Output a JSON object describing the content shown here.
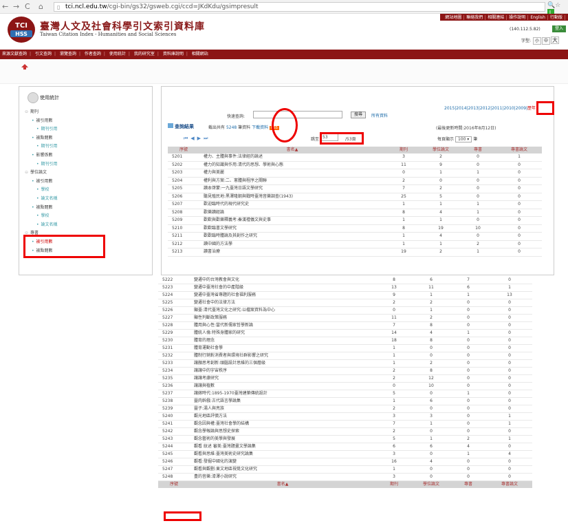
{
  "browser": {
    "url_host": "tci.ncl.edu.tw",
    "url_path": "/cgi-bin/gs32/gsweb.cgi/ccd=JKdKdu/gsimpresult",
    "back_icon": "arrow-left-icon",
    "forward_icon": "arrow-right-icon",
    "reload_icon": "reload-icon",
    "home_icon": "home-icon"
  },
  "header": {
    "title_zh": "臺灣人文及社會科學引文索引資料庫",
    "title_en": "Taiwan Citation Index - Humanities and Social Sciences",
    "logo_line1": "TCI",
    "logo_line2": "HSS",
    "top_links": [
      "網站地圖",
      "聯絡我們",
      "相關連結",
      "操作說明",
      "English",
      "行動版"
    ],
    "ip": "(140.112.5.82)",
    "login": "登入",
    "font_size_label": "字型:",
    "font_sizes": [
      "小",
      "中",
      "大"
    ]
  },
  "nav": {
    "items": [
      "來源文獻查詢",
      "引文查詢",
      "瀏覽查詢",
      "作者查詢",
      "使用統計",
      "我的研究室",
      "資料庫說明",
      "相關網站"
    ]
  },
  "left": {
    "title": "使用統計",
    "tree": [
      {
        "level": 1,
        "text": "期刊"
      },
      {
        "level": 2,
        "text": "被引用數"
      },
      {
        "level": 3,
        "text": "期刊引用"
      },
      {
        "level": 2,
        "text": "被點閱數"
      },
      {
        "level": 3,
        "text": "期刊引用"
      },
      {
        "level": 2,
        "text": "影響係數"
      },
      {
        "level": 3,
        "text": "期刊引用"
      },
      {
        "level": 1,
        "text": "學位論文"
      },
      {
        "level": 2,
        "text": "被引用數"
      },
      {
        "level": 3,
        "text": "學校"
      },
      {
        "level": 3,
        "text": "論文名稱"
      },
      {
        "level": 2,
        "text": "被點閱數"
      },
      {
        "level": 3,
        "text": "學校"
      },
      {
        "level": 3,
        "text": "論文名稱"
      },
      {
        "level": 1,
        "text": "專書"
      },
      {
        "level": 2,
        "text": "被引用數",
        "selected": true
      },
      {
        "level": 2,
        "text": "被點閱數"
      }
    ]
  },
  "main": {
    "quick_search_label": "快速查詢:",
    "search_button": "搜尋",
    "all_data": "所有資料",
    "years": "2015|2014|2013|2012|2011|2010|2009|",
    "prev_year": "歷年",
    "result_title": "查詢結果",
    "result_info_pre": "截出共有",
    "result_count": "5248",
    "result_info_mid": "筆資料",
    "download": "下載資料",
    "rss": "RSS",
    "updated": "(最後更新時間:2016年8月12日)",
    "jump_label": "跳至",
    "page_current": "53",
    "page_total": "/53頁",
    "per_page_label": "每頁顯示",
    "per_page": "100",
    "per_page_unit": "筆",
    "columns": {
      "no": "序號",
      "name": "書名",
      "journal": "期刊",
      "thesis": "學位論文",
      "book": "專書",
      "book_thesis": "專書論文"
    },
    "rows_top": [
      [
        "5201",
        "權力、主體與事件:法律經的論述",
        "3",
        "2",
        "0",
        "1"
      ],
      [
        "5202",
        "權力的知識與作用:清代的思想、學術與心態",
        "11",
        "9",
        "0",
        "0"
      ],
      [
        "5203",
        "權力與美麗",
        "0",
        "1",
        "1",
        "0"
      ],
      [
        "5204",
        "權利與方案:二、憲體與程序之關聯",
        "2",
        "0",
        "0",
        "0"
      ],
      [
        "5205",
        "讀本啓蒙:一九臺灣日語文學研究",
        "7",
        "2",
        "0",
        "0"
      ],
      [
        "5206",
        "聽見殖民地:黑澤隆朝與戰時臺灣音樂調查(1943)",
        "25",
        "5",
        "0",
        "0"
      ],
      [
        "5207",
        "歡迎臨時代的現代研究史",
        "1",
        "1",
        "1",
        "0"
      ],
      [
        "5208",
        "歡樂讀經論",
        "8",
        "4",
        "1",
        "0"
      ],
      [
        "5209",
        "歡歎與歡樂釋義考:秦漢禮儀文與史事",
        "1",
        "1",
        "0",
        "0"
      ],
      [
        "5210",
        "歡歎臨書文學研究",
        "8",
        "19",
        "10",
        "0"
      ],
      [
        "5211",
        "歡歡臨時體論及其創作之研究",
        "1",
        "4",
        "0",
        "0"
      ],
      [
        "5212",
        "讀中國的方法學",
        "1",
        "1",
        "2",
        "0"
      ],
      [
        "5213",
        "讀書治療",
        "19",
        "2",
        "1",
        "0"
      ]
    ],
    "rows_bottom": [
      [
        "5222",
        "變遷中的台灣教會與文化",
        "8",
        "6",
        "7",
        "0"
      ],
      [
        "5223",
        "變遷中臺灣社會的中產階級",
        "13",
        "11",
        "6",
        "1"
      ],
      [
        "5224",
        "變遷中臺灣省專題的社會福利服務",
        "9",
        "1",
        "1",
        "13"
      ],
      [
        "5225",
        "變遷社會中的法律方法",
        "2",
        "2",
        "0",
        "0"
      ],
      [
        "5226",
        "顯臺:清代臺灣文化之研究:以檔案資料為中心",
        "0",
        "1",
        "0",
        "0"
      ],
      [
        "5227",
        "顯性判斷政策服務",
        "11",
        "2",
        "0",
        "0"
      ],
      [
        "5228",
        "體用與心性:當代新儒家哲學新論",
        "7",
        "8",
        "0",
        "0"
      ],
      [
        "5229",
        "體統人倫:特殊身體家的研究",
        "14",
        "4",
        "1",
        "0"
      ],
      [
        "5230",
        "體育的理念",
        "18",
        "8",
        "0",
        "0"
      ],
      [
        "5231",
        "體育運動社會學",
        "1",
        "0",
        "0",
        "0"
      ],
      [
        "5232",
        "體制行銷對消費者與環境社群影響之研究",
        "1",
        "0",
        "0",
        "0"
      ],
      [
        "5233",
        "讓顏思考創新:頭腦設計思維的三個層級",
        "1",
        "2",
        "0",
        "0"
      ],
      [
        "5234",
        "讓讓中的宇宙秩序",
        "2",
        "8",
        "0",
        "0"
      ],
      [
        "5235",
        "讓讓考慮研究",
        "2",
        "12",
        "0",
        "0"
      ],
      [
        "5236",
        "讓讓與植數",
        "0",
        "10",
        "0",
        "0"
      ],
      [
        "5237",
        "讓嫁時代:1895-1970臺灣建築傳統設計",
        "5",
        "0",
        "1",
        "0"
      ],
      [
        "5238",
        "靈肉幹戲:古代語言學論集",
        "1",
        "6",
        "0",
        "0"
      ],
      [
        "5239",
        "靈子:湯人與亮族",
        "2",
        "0",
        "0",
        "0"
      ],
      [
        "5240",
        "觀光地區評價方法",
        "3",
        "3",
        "0",
        "1"
      ],
      [
        "5241",
        "觀念因與權:臺灣社會學的結構",
        "7",
        "1",
        "0",
        "1"
      ],
      [
        "5242",
        "觀念學報論與思想史探索",
        "2",
        "0",
        "0",
        "0"
      ],
      [
        "5243",
        "觀念藝術的美學與發展",
        "5",
        "1",
        "2",
        "1"
      ],
      [
        "5244",
        "觀看 紋述 審美:臺灣題畫文學論集",
        "6",
        "6",
        "4",
        "0"
      ],
      [
        "5245",
        "觀看與思維:臺灣美術史研究論集",
        "3",
        "0",
        "1",
        "4"
      ],
      [
        "5246",
        "觀看:發掘中國化的演變",
        "16",
        "4",
        "0",
        "0"
      ],
      [
        "5247",
        "觀看與觀劃:東文地區視覺文化研究",
        "1",
        "0",
        "0",
        "0"
      ],
      [
        "5248",
        "豊的音樂:漆澤小說研究",
        "3",
        "0",
        "0",
        "0"
      ]
    ]
  },
  "colors": {
    "brand": "#8c1515",
    "link": "#1a6aa8",
    "annotation": "#e00000",
    "header_row": "#d4d4d4"
  }
}
